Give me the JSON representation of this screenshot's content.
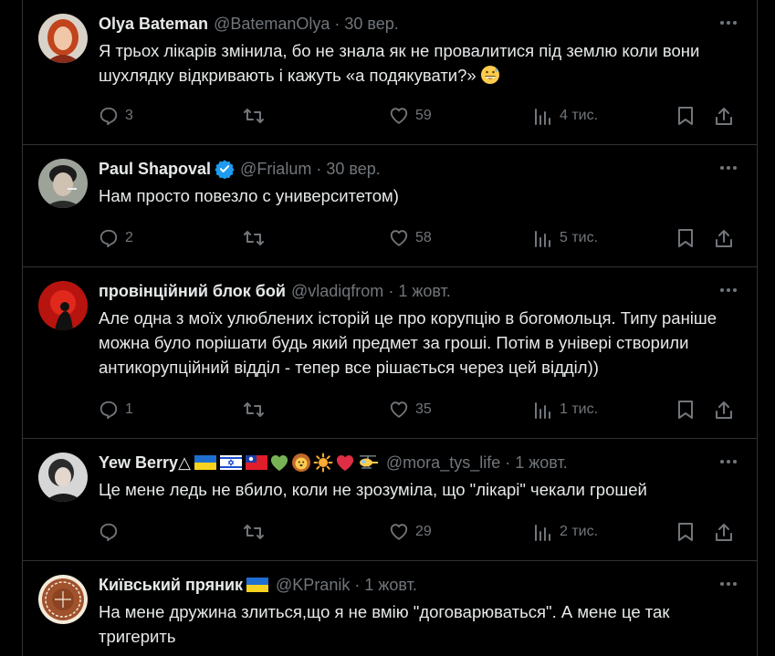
{
  "colors": {
    "background": "#000000",
    "text": "#e7e9ea",
    "muted": "#71767b",
    "divider": "#2f3336",
    "verified": "#1d9bf0"
  },
  "tweets": [
    {
      "name": "Olya Bateman",
      "handle": "@BatemanOlya",
      "dot": "·",
      "date": "30 вер.",
      "text": "Я трьох лікарів змінила, бо не знала як не провалитися під землю коли вони шухлядку відкривають і кажуть «а подякувати?»",
      "text_emoji": "grinning-face-with-sweat",
      "replies": "3",
      "reposts": "",
      "likes": "59",
      "views": "4 тис."
    },
    {
      "name": "Paul Shapoval",
      "verified": true,
      "handle": "@Frialum",
      "dot": "·",
      "date": "30 вер.",
      "text": "Нам просто повезло с университетом)",
      "replies": "2",
      "reposts": "",
      "likes": "58",
      "views": "5 тис."
    },
    {
      "name": "провінційний блок бой",
      "handle": "@vladiqfrom",
      "dot": "·",
      "date": "1 жовт.",
      "text": "Але одна з моїх улюблених історій це про корупцію в богомольця. Типу раніше можна було порішати будь який предмет за гроші. Потім в універі створили антикорупційний відділ - тепер все рішається через цей відділ))",
      "replies": "1",
      "reposts": "",
      "likes": "35",
      "views": "1 тис."
    },
    {
      "name": "Yew Berry",
      "name_suffix": "△",
      "name_emojis": [
        "flag-ukraine",
        "flag-israel",
        "flag-taiwan",
        "green-heart",
        "lion-face",
        "sun",
        "red-heart",
        "helicopter"
      ],
      "handle": "@mora_tys_life",
      "dot": "·",
      "date": "1 жовт.",
      "text": "Це мене ледь не вбило, коли не зрозуміла, що \"лікарі\" чекали грошей",
      "replies": "",
      "reposts": "",
      "likes": "29",
      "views": "2 тис."
    },
    {
      "name": "Київський пряник",
      "name_emojis": [
        "flag-ukraine"
      ],
      "handle": "@KPranik",
      "dot": "·",
      "date": "1 жовт.",
      "text": "На мене дружина злиться,що я не вмію \"договарюваться\". А мене це так тригерить"
    }
  ]
}
